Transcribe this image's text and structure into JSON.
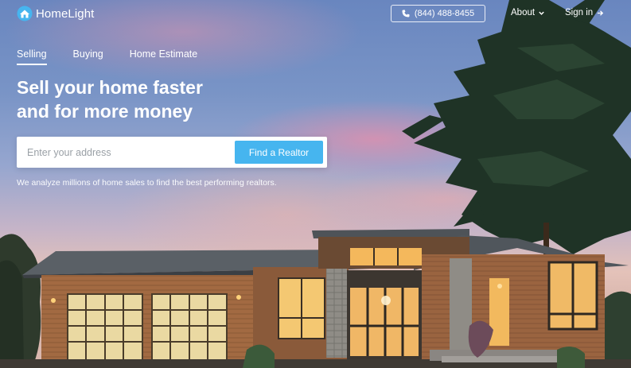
{
  "brand": {
    "name": "HomeLight",
    "accent": "#46b5ef"
  },
  "header": {
    "phone": "(844) 488-8455",
    "about_label": "About",
    "signin_label": "Sign in",
    "icons": {
      "phone": "phone-icon",
      "about": "chevron-down-icon",
      "signin": "arrow-right-icon"
    }
  },
  "tabs": [
    {
      "label": "Selling",
      "active": true
    },
    {
      "label": "Buying",
      "active": false
    },
    {
      "label": "Home Estimate",
      "active": false
    }
  ],
  "hero": {
    "headline_line1": "Sell your home faster",
    "headline_line2": "and for more money",
    "search_placeholder": "Enter your address",
    "search_value": "",
    "button_label": "Find a Realtor",
    "tagline": "We analyze millions of home sales to find the best performing realtors."
  }
}
